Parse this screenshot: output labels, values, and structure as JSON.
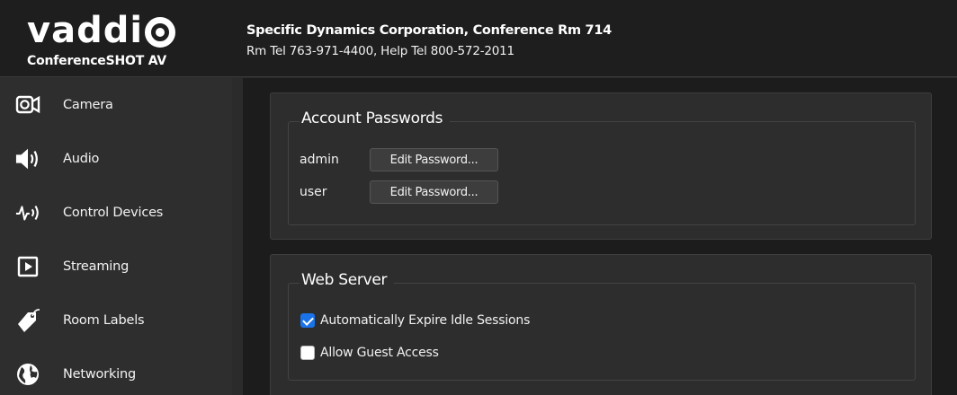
{
  "header": {
    "logo_text": "vaddi",
    "product": "ConferenceSHOT AV",
    "title": "Specific Dynamics Corporation, Conference Rm 714",
    "subtitle": "Rm Tel 763-971-4400, Help Tel 800-572-2011"
  },
  "sidebar": {
    "items": [
      {
        "label": "Camera",
        "icon": "camera-icon"
      },
      {
        "label": "Audio",
        "icon": "speaker-icon"
      },
      {
        "label": "Control Devices",
        "icon": "control-signal-icon"
      },
      {
        "label": "Streaming",
        "icon": "play-icon"
      },
      {
        "label": "Room Labels",
        "icon": "tag-icon"
      },
      {
        "label": "Networking",
        "icon": "globe-icon"
      }
    ]
  },
  "account_passwords": {
    "legend": "Account Passwords",
    "rows": [
      {
        "user": "admin",
        "button": "Edit Password..."
      },
      {
        "user": "user",
        "button": "Edit Password..."
      }
    ]
  },
  "web_server": {
    "legend": "Web Server",
    "options": [
      {
        "label": "Automatically Expire Idle Sessions",
        "checked": true
      },
      {
        "label": "Allow Guest Access",
        "checked": false
      }
    ]
  },
  "colors": {
    "accent": "#1a73e8",
    "header_bg": "#1e1e1e",
    "sidebar_bg": "#2e2e2e",
    "content_bg": "#1c1c1c",
    "panel_bg": "#2d2d2d"
  }
}
